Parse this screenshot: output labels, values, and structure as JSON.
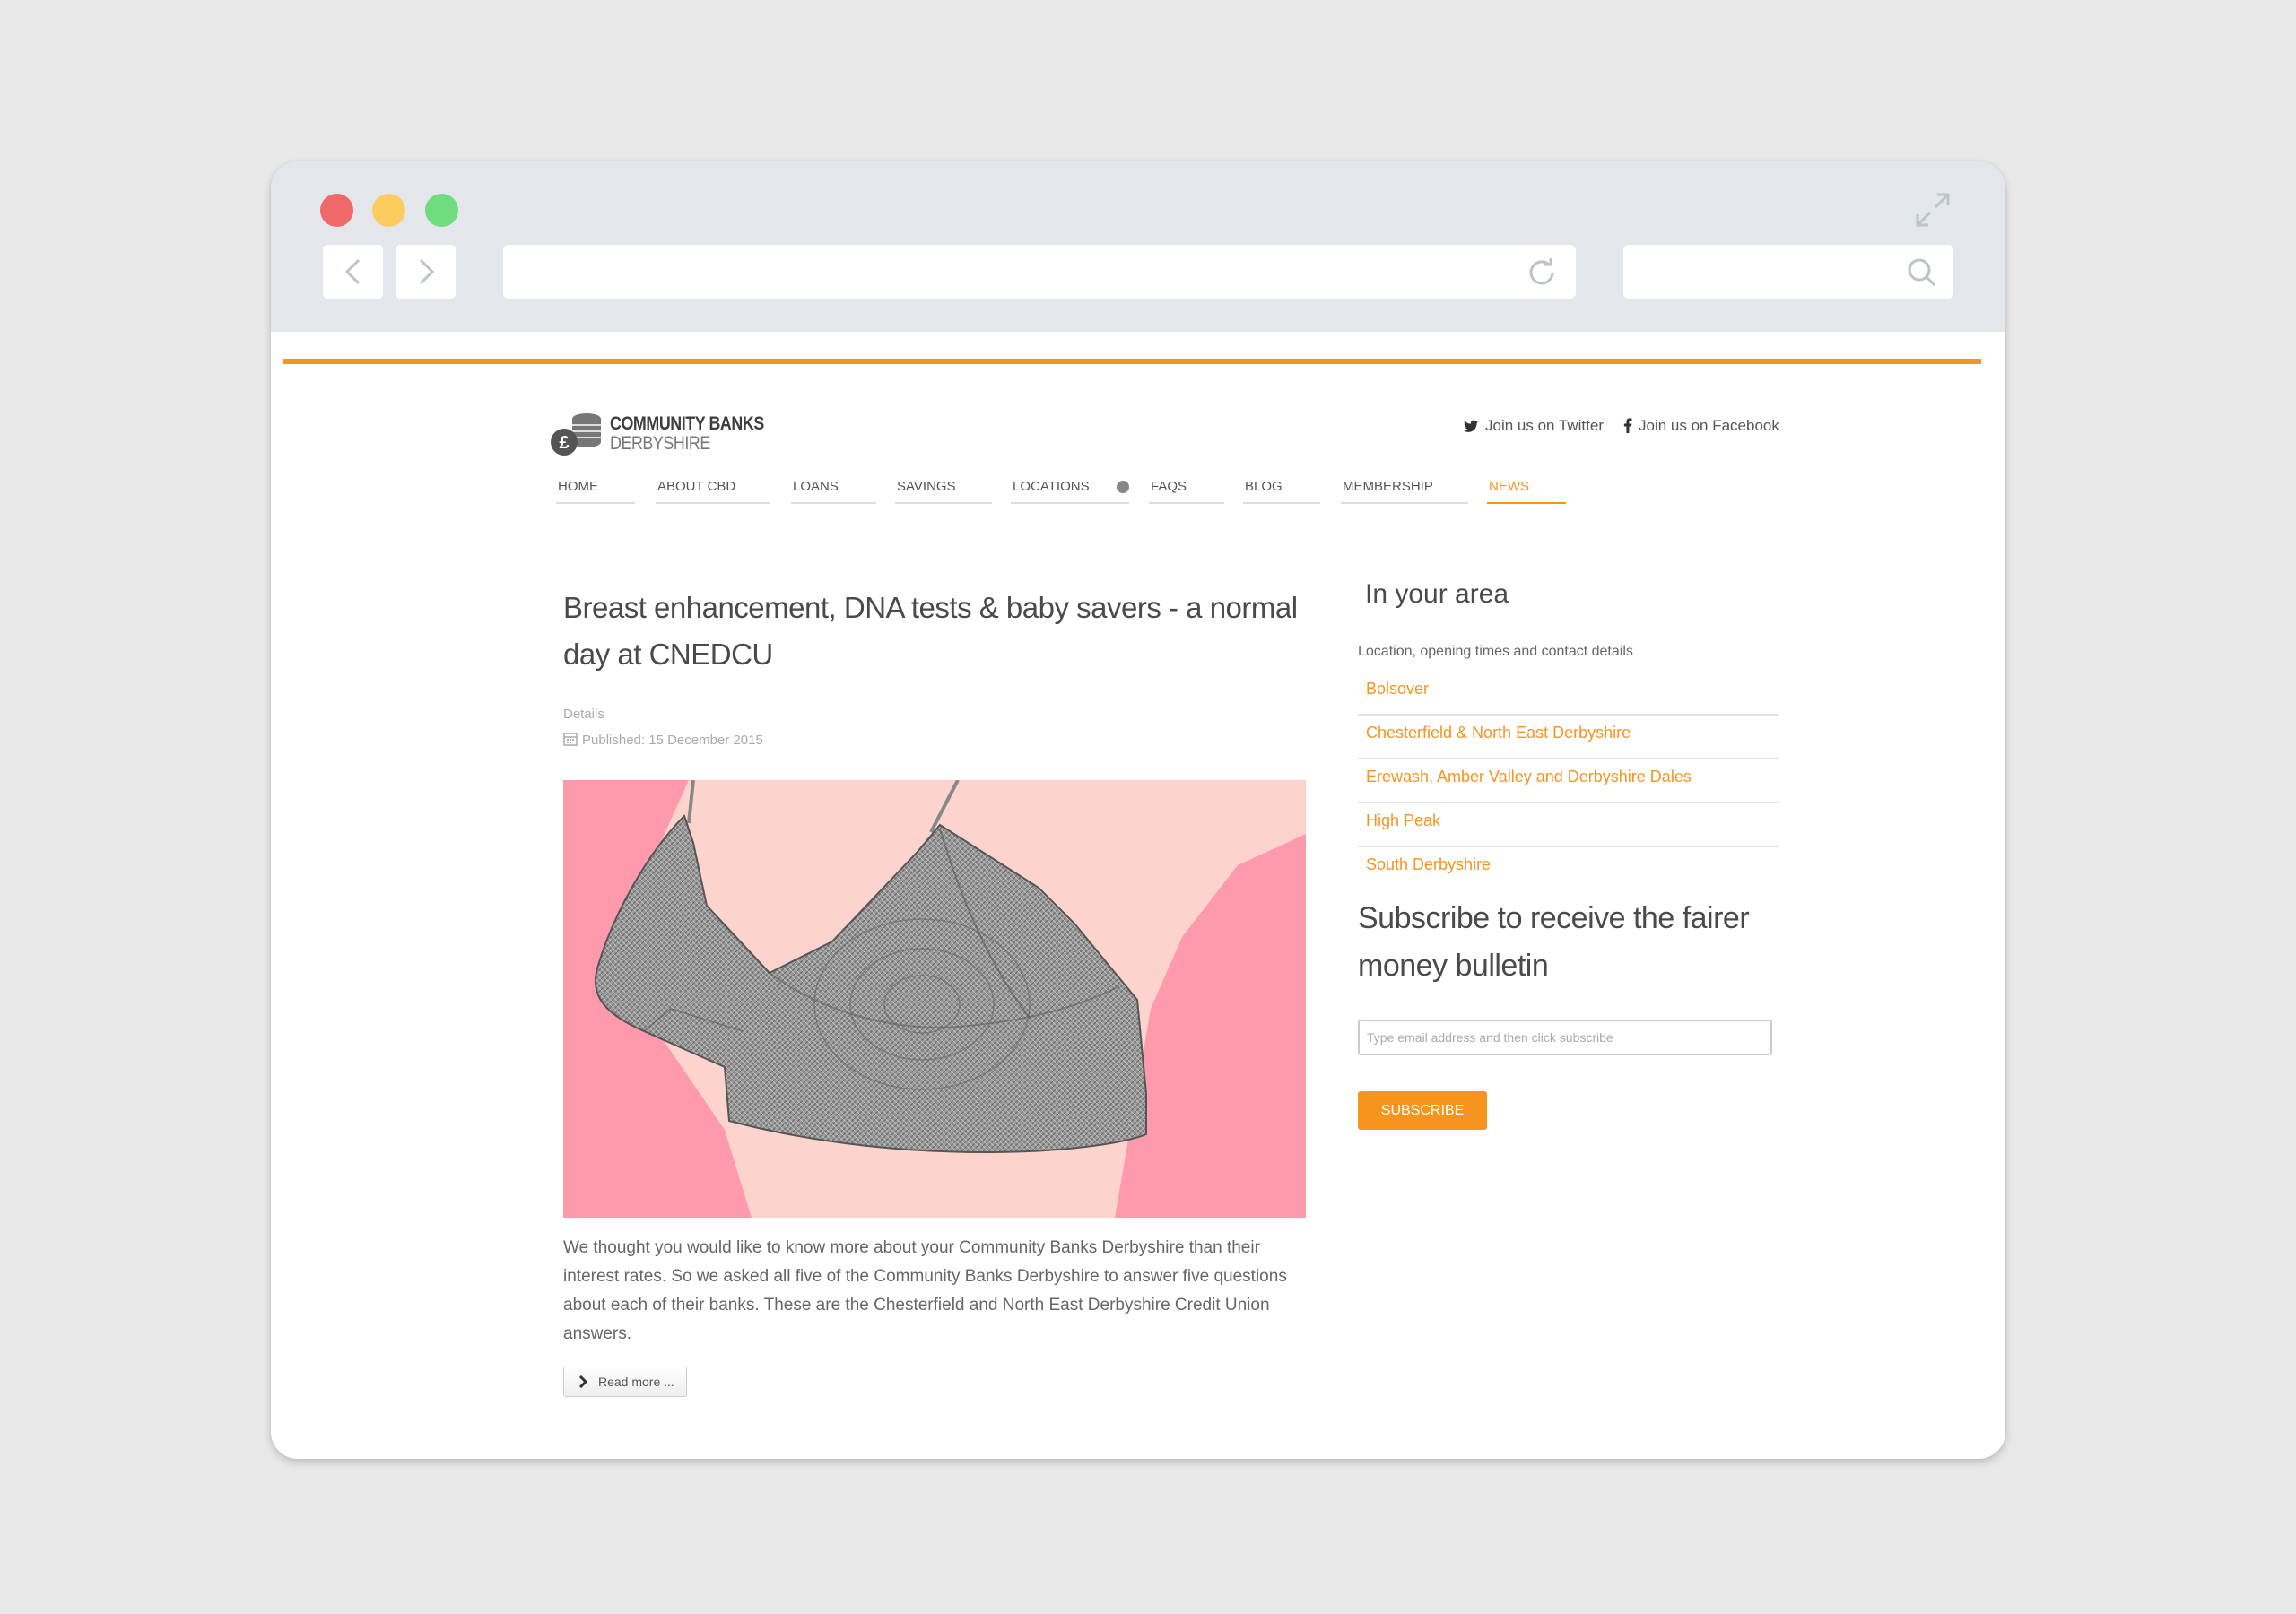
{
  "site": {
    "logo_line1": "COMMUNITY BANKS",
    "logo_line2": "DERBYSHIRE",
    "social": {
      "twitter": "Join us on Twitter",
      "facebook": "Join us on Facebook"
    },
    "accent_color": "#f7941e"
  },
  "nav": {
    "items": [
      {
        "label": "HOME"
      },
      {
        "label": "ABOUT CBD"
      },
      {
        "label": "LOANS"
      },
      {
        "label": "SAVINGS"
      },
      {
        "label": "LOCATIONS"
      },
      {
        "label": "FAQS"
      },
      {
        "label": "BLOG"
      },
      {
        "label": "MEMBERSHIP"
      },
      {
        "label": "NEWS"
      }
    ],
    "active": "NEWS"
  },
  "article": {
    "title": "Breast enhancement, DNA tests & baby savers - a normal day at CNEDCU",
    "details_label": "Details",
    "published": "Published: 15 December 2015",
    "body": "We thought you would like to know more about your Community Banks Derbyshire than their interest rates. So we asked all five of the Community Banks Derbyshire to answer five questions about each of their banks. These are the Chesterfield and North East Derbyshire Credit Union answers.",
    "read_more": "Read more ..."
  },
  "sidebar": {
    "area_title": "In your area",
    "area_subtitle": "Location, opening times and contact details",
    "locations": [
      "Bolsover",
      "Chesterfield & North East Derbyshire",
      "Erewash, Amber Valley and Derbyshire Dales",
      "High Peak",
      "South Derbyshire"
    ],
    "subscribe_title": "Subscribe to receive the fairer money bulletin",
    "email_placeholder": "Type email address and then click subscribe",
    "subscribe_button": "SUBSCRIBE"
  }
}
